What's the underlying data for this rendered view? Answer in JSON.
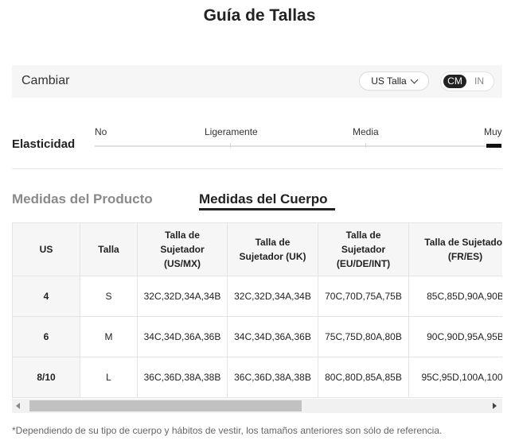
{
  "title": "Guía de Tallas",
  "switch": {
    "label": "Cambiar",
    "size_system": "US Talla",
    "units": [
      "CM",
      "IN"
    ],
    "selected_unit": "CM"
  },
  "elasticity": {
    "title": "Elasticidad",
    "levels": [
      "No",
      "Ligeramente",
      "Media",
      "Muy"
    ],
    "selected": "Muy"
  },
  "tabs": {
    "product": "Medidas del Producto",
    "body": "Medidas del Cuerpo",
    "active": "Medidas del Cuerpo"
  },
  "table": {
    "headers": [
      [
        "US"
      ],
      [
        "Talla"
      ],
      [
        "Talla de",
        "Sujetador",
        "(US/MX)"
      ],
      [
        "Talla de",
        "Sujetador (UK)"
      ],
      [
        "Talla de",
        "Sujetador",
        "(EU/DE/INT)"
      ],
      [
        "Talla de Sujetador",
        "(FR/ES)"
      ]
    ],
    "rows": [
      [
        "4",
        "S",
        "32C,32D,34A,34B",
        "32C,32D,34A,34B",
        "70C,70D,75A,75B",
        "85C,85D,90A,90B"
      ],
      [
        "6",
        "M",
        "34C,34D,36A,36B",
        "34C,34D,36A,36B",
        "75C,75D,80A,80B",
        "90C,90D,95A,95B"
      ],
      [
        "8/10",
        "L",
        "36C,36D,38A,38B",
        "36C,36D,38A,38B",
        "80C,80D,85A,85B",
        "95C,95D,100A,100B"
      ]
    ]
  },
  "note": "*Dependiendo de su tipo de cuerpo y hábitos de vestir, los tamaños anteriores son sólo de referencia.",
  "icons": {
    "size_select": "chevron-down-icon",
    "scroll_left": "scroll-left-arrow-icon",
    "scroll_right": "scroll-right-arrow-icon"
  }
}
